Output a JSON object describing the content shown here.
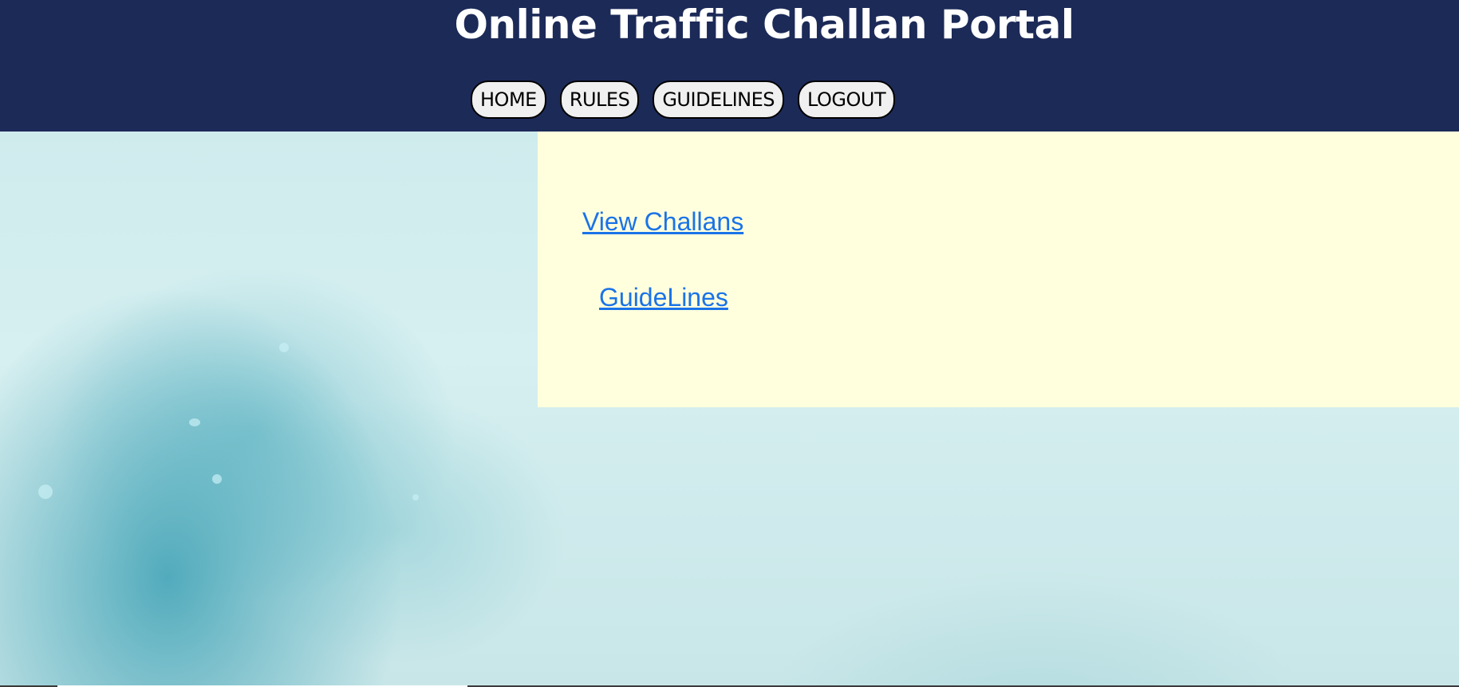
{
  "header": {
    "title": "Online Traffic Challan Portal"
  },
  "nav": {
    "items": [
      {
        "label": "HOME"
      },
      {
        "label": "RULES"
      },
      {
        "label": "GUIDELINES"
      },
      {
        "label": "LOGOUT"
      }
    ]
  },
  "main": {
    "links": [
      {
        "label": "View Challans"
      },
      {
        "label": "GuideLines"
      }
    ]
  },
  "colors": {
    "header_bg": "#1c2a58",
    "panel_bg": "#ffffdd",
    "link": "#1a73e8"
  }
}
